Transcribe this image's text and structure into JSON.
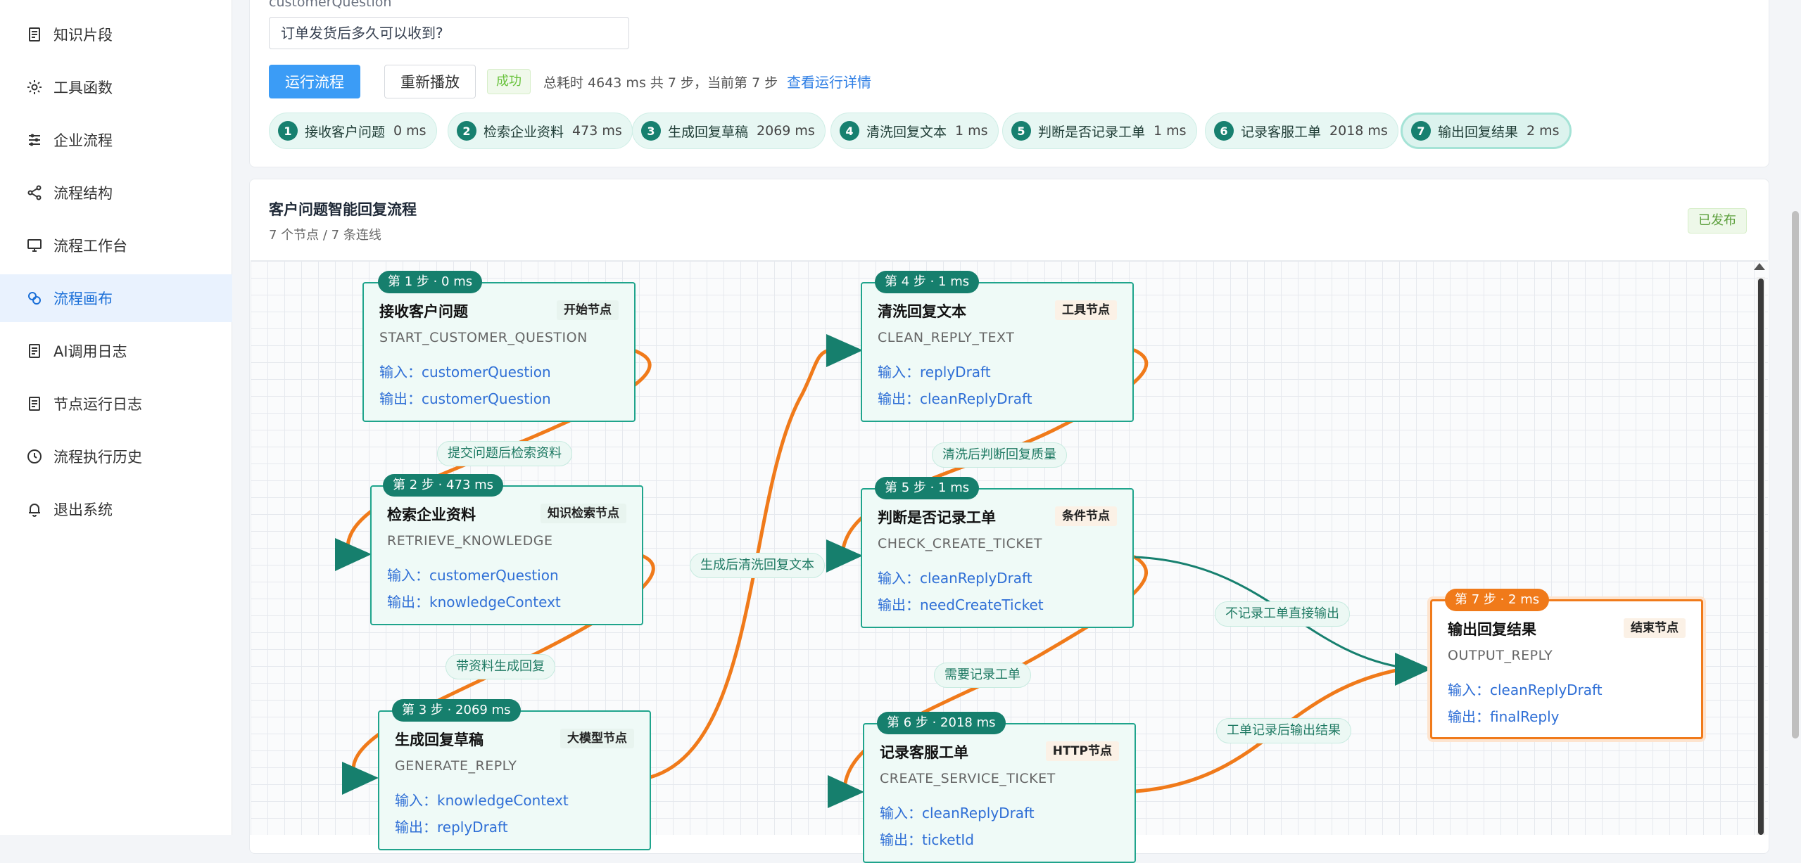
{
  "sidebar": {
    "items": [
      {
        "label": "知识片段",
        "icon": "document-icon"
      },
      {
        "label": "工具函数",
        "icon": "gear-icon"
      },
      {
        "label": "企业流程",
        "icon": "sliders-icon"
      },
      {
        "label": "流程结构",
        "icon": "share-icon"
      },
      {
        "label": "流程工作台",
        "icon": "monitor-icon"
      },
      {
        "label": "流程画布",
        "icon": "canvas-icon",
        "active": true
      },
      {
        "label": "AI调用日志",
        "icon": "document-icon"
      },
      {
        "label": "节点运行日志",
        "icon": "document-icon"
      },
      {
        "label": "流程执行历史",
        "icon": "clock-icon"
      },
      {
        "label": "退出系统",
        "icon": "bell-icon"
      }
    ]
  },
  "run_panel": {
    "field_label": "customerQuestion",
    "question_value": "订单发货后多久可以收到?",
    "run_button": "运行流程",
    "replay_button": "重新播放",
    "status": "成功",
    "summary": "总耗时 4643 ms   共 7 步，当前第 7 步",
    "detail_link": "查看运行详情",
    "steps": [
      {
        "num": "1",
        "name": "接收客户问题",
        "ms": "0 ms"
      },
      {
        "num": "2",
        "name": "检索企业资料",
        "ms": "473 ms"
      },
      {
        "num": "3",
        "name": "生成回复草稿",
        "ms": "2069 ms"
      },
      {
        "num": "4",
        "name": "清洗回复文本",
        "ms": "1 ms"
      },
      {
        "num": "5",
        "name": "判断是否记录工单",
        "ms": "1 ms"
      },
      {
        "num": "6",
        "name": "记录客服工单",
        "ms": "2018 ms"
      },
      {
        "num": "7",
        "name": "输出回复结果",
        "ms": "2 ms"
      }
    ]
  },
  "canvas": {
    "title": "客户问题智能回复流程",
    "subtitle": "7 个节点 / 7 条连线",
    "status_badge": "已发布",
    "nodes": [
      {
        "step": "第 1 步 · 0 ms",
        "title": "接收客户问题",
        "type": "开始节点",
        "code": "START_CUSTOMER_QUESTION",
        "input": "输入：customerQuestion",
        "output": "输出：customerQuestion"
      },
      {
        "step": "第 2 步 · 473 ms",
        "title": "检索企业资料",
        "type": "知识检索节点",
        "code": "RETRIEVE_KNOWLEDGE",
        "input": "输入：customerQuestion",
        "output": "输出：knowledgeContext"
      },
      {
        "step": "第 3 步 · 2069 ms",
        "title": "生成回复草稿",
        "type": "大模型节点",
        "code": "GENERATE_REPLY",
        "input": "输入：knowledgeContext",
        "output": "输出：replyDraft"
      },
      {
        "step": "第 4 步 · 1 ms",
        "title": "清洗回复文本",
        "type": "工具节点",
        "code": "CLEAN_REPLY_TEXT",
        "input": "输入：replyDraft",
        "output": "输出：cleanReplyDraft"
      },
      {
        "step": "第 5 步 · 1 ms",
        "title": "判断是否记录工单",
        "type": "条件节点",
        "code": "CHECK_CREATE_TICKET",
        "input": "输入：cleanReplyDraft",
        "output": "输出：needCreateTicket"
      },
      {
        "step": "第 6 步 · 2018 ms",
        "title": "记录客服工单",
        "type": "HTTP节点",
        "code": "CREATE_SERVICE_TICKET",
        "input": "输入：cleanReplyDraft",
        "output": "输出：ticketId"
      },
      {
        "step": "第 7 步 · 2 ms",
        "title": "输出回复结果",
        "type": "结束节点",
        "code": "OUTPUT_REPLY",
        "input": "输入：cleanReplyDraft",
        "output": "输出：finalReply"
      }
    ],
    "edge_labels": [
      "提交问题后检索资料",
      "带资料生成回复",
      "生成后清洗回复文本",
      "清洗后判断回复质量",
      "需要记录工单",
      "不记录工单直接输出",
      "工单记录后输出结果"
    ]
  },
  "colors": {
    "accent": "#3b9cf6",
    "node_border": "#1fa48c",
    "node_bg": "#effaf7",
    "edge_active": "#f07a1a",
    "edge_teal": "#17806f",
    "current_node": "#f07a1a"
  }
}
